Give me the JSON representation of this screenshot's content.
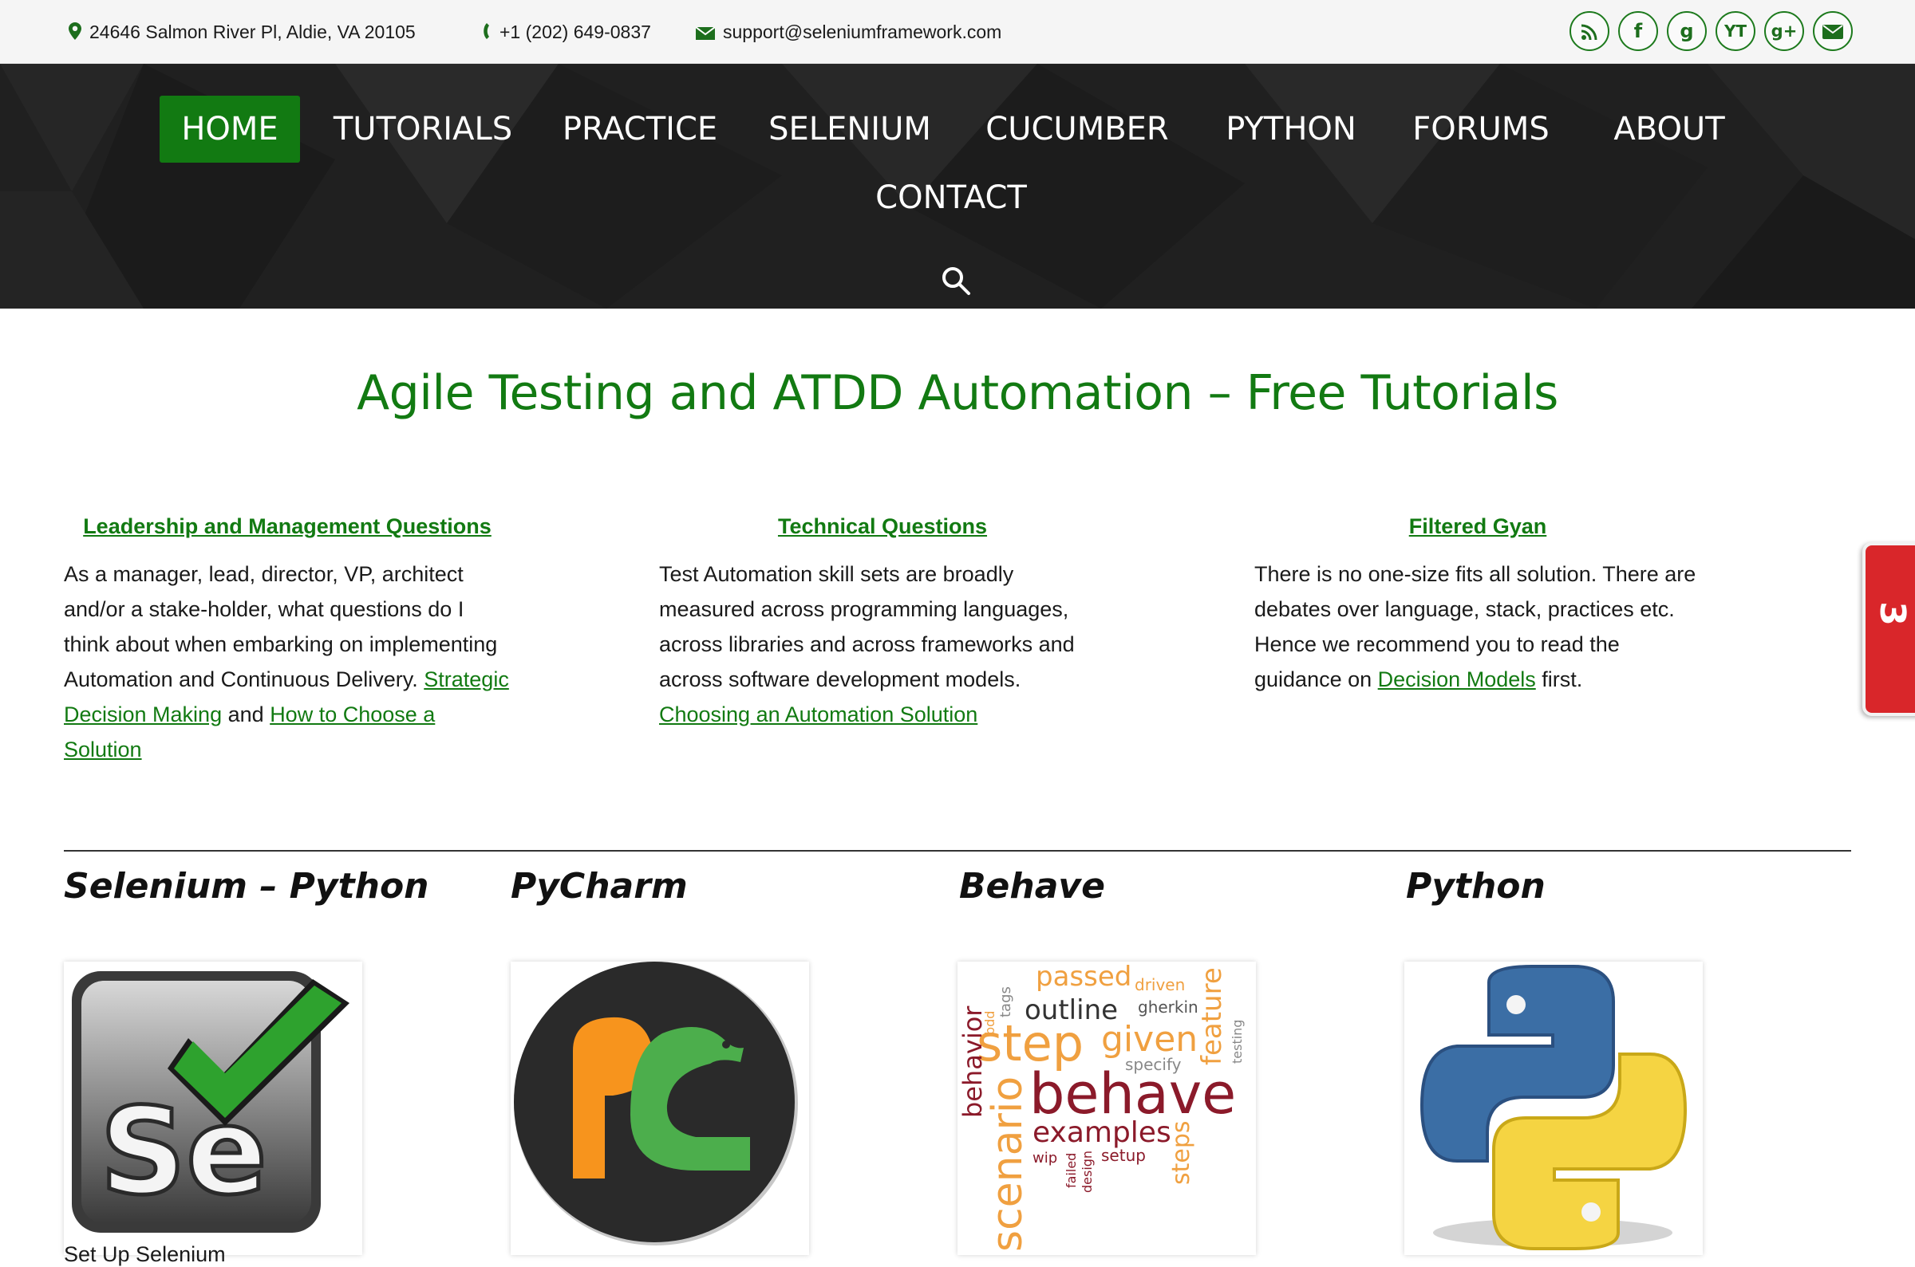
{
  "topbar": {
    "address": "24646 Salmon River Pl, Aldie, VA 20105",
    "phone": "+1 (202) 649-0837",
    "email": "support@seleniumframework.com",
    "socials": [
      {
        "name": "rss-icon",
        "label": ""
      },
      {
        "name": "facebook-icon",
        "label": "f"
      },
      {
        "name": "goodreads-icon",
        "label": "g"
      },
      {
        "name": "youtube-icon",
        "label": "YT"
      },
      {
        "name": "google-plus-icon",
        "label": "g+"
      },
      {
        "name": "mail-icon",
        "label": ""
      }
    ]
  },
  "nav": {
    "items": [
      "HOME",
      "TUTORIALS",
      "PRACTICE",
      "SELENIUM",
      "CUCUMBER",
      "PYTHON",
      "FORUMS",
      "ABOUT",
      "CONTACT"
    ],
    "active": "HOME"
  },
  "headline": "Agile Testing and ATDD Automation –  Free Tutorials",
  "columns": [
    {
      "title": "Leadership and Management Questions",
      "text": "As a manager, lead, director, VP, architect and/or a stake-holder, what questions do I think about when embarking on implementing Automation and Continuous Delivery.",
      "link1": "Strategic Decision Making",
      "joiner": "and",
      "link2": "How to Choose a Solution"
    },
    {
      "title": "Technical Questions",
      "text": "Test Automation skill sets are broadly measured across programming languages, across libraries and across frameworks and across software development models.",
      "link1": "Choosing an Automation Solution"
    },
    {
      "title": "Filtered Gyan",
      "text_before": "There is no one-size fits all solution. There are debates over language, stack, practices etc. Hence we recommend you to read the guidance on",
      "link1": "Decision Models",
      "text_after": "first."
    }
  ],
  "sections": [
    "Selenium – Python",
    "PyCharm",
    "Behave",
    "Python"
  ],
  "sections_sub": "Set Up Selenium",
  "wordcloud": {
    "words": [
      "passed",
      "driven",
      "tags",
      "bdd",
      "outline",
      "gherkin",
      "step",
      "given",
      "feature",
      "testing",
      "specify",
      "behavior",
      "behave",
      "scenario",
      "examples",
      "steps",
      "wip",
      "failed",
      "design",
      "setup"
    ]
  },
  "sidetab": {
    "label": "3"
  },
  "colors": {
    "brand": "#127a12",
    "nav_bg": "#222222",
    "topbar_bg": "#f5f5f5",
    "sidetab": "#d9262a"
  }
}
